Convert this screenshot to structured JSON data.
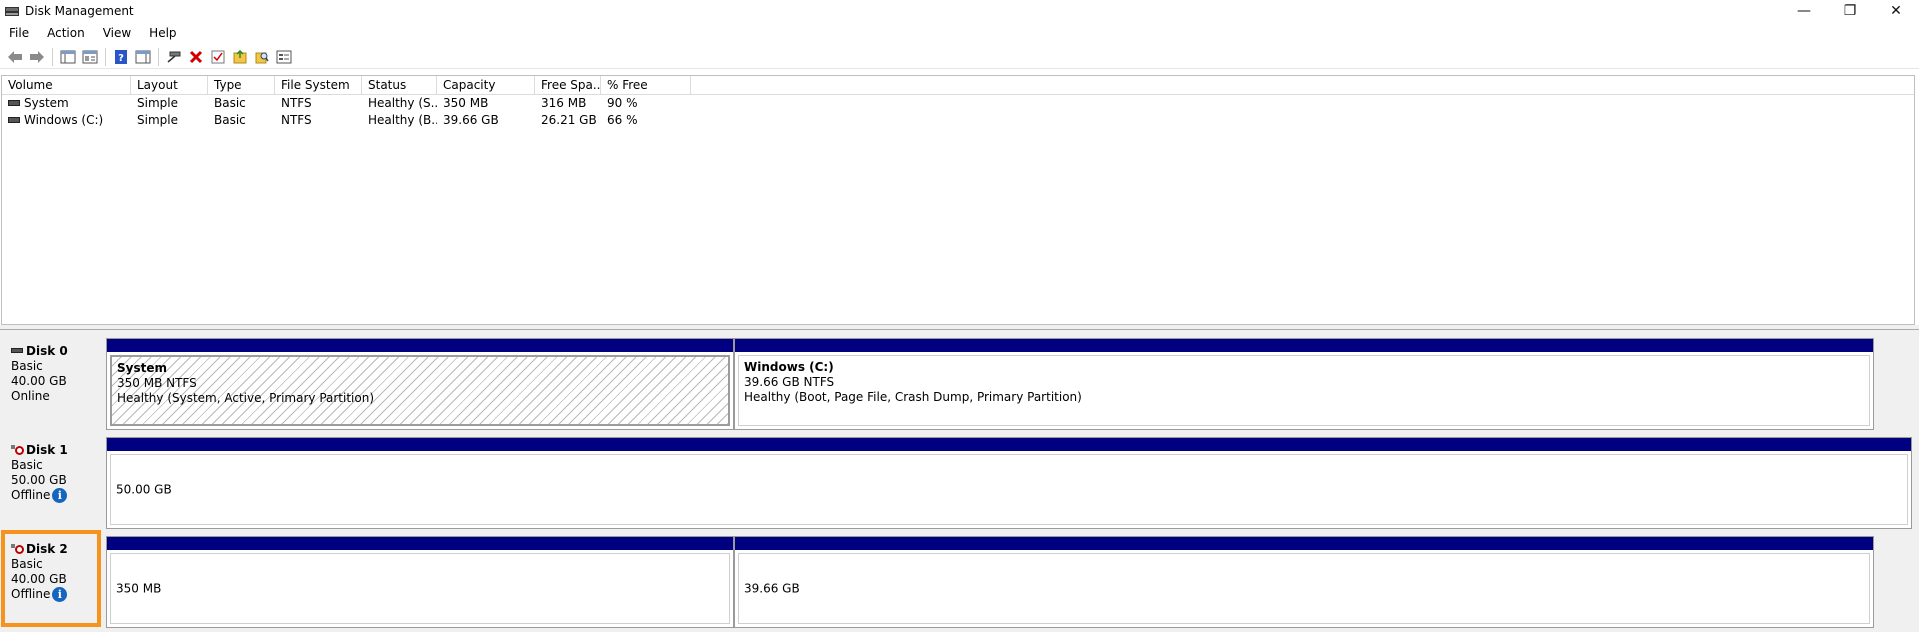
{
  "window": {
    "title": "Disk Management",
    "controls": {
      "minimize": "—",
      "restore": "❐",
      "close": "✕"
    }
  },
  "menu": {
    "items": [
      "File",
      "Action",
      "View",
      "Help"
    ]
  },
  "toolbar": {
    "buttons": [
      "back-icon",
      "forward-icon",
      "console-tree-icon",
      "properties-icon",
      "help-icon",
      "show-hide-icon",
      "connect-icon",
      "delete-icon",
      "check-icon",
      "new-folder-icon",
      "find-icon",
      "view-icon"
    ]
  },
  "volume_list": {
    "columns": [
      "Volume",
      "Layout",
      "Type",
      "File System",
      "Status",
      "Capacity",
      "Free Spa...",
      "% Free"
    ],
    "rows": [
      [
        "System",
        "Simple",
        "Basic",
        "NTFS",
        "Healthy (S...",
        "350 MB",
        "316 MB",
        "90 %"
      ],
      [
        "Windows (C:)",
        "Simple",
        "Basic",
        "NTFS",
        "Healthy (B...",
        "39.66 GB",
        "26.21 GB",
        "66 %"
      ]
    ]
  },
  "disks": [
    {
      "name": "Disk 0",
      "type": "Basic",
      "size": "40.00 GB",
      "status": "Online",
      "partitions": [
        {
          "name": "System",
          "fs": "350 MB NTFS",
          "health": "Healthy (System, Active, Primary Partition)"
        },
        {
          "name": "Windows  (C:)",
          "fs": "39.66 GB NTFS",
          "health": "Healthy (Boot, Page File, Crash Dump, Primary Partition)"
        }
      ]
    },
    {
      "name": "Disk 1",
      "type": "Basic",
      "size": "50.00 GB",
      "status": "Offline",
      "partitions": [
        {
          "size": "50.00 GB"
        }
      ]
    },
    {
      "name": "Disk 2",
      "type": "Basic",
      "size": "40.00 GB",
      "status": "Offline",
      "partitions": [
        {
          "size": "350 MB"
        },
        {
          "size": "39.66 GB"
        }
      ]
    }
  ],
  "colors": {
    "partition_bar": "#000080",
    "selection": "#f6921e",
    "info": "#1565c0",
    "offline": "#c00000"
  },
  "info_glyph": "i"
}
